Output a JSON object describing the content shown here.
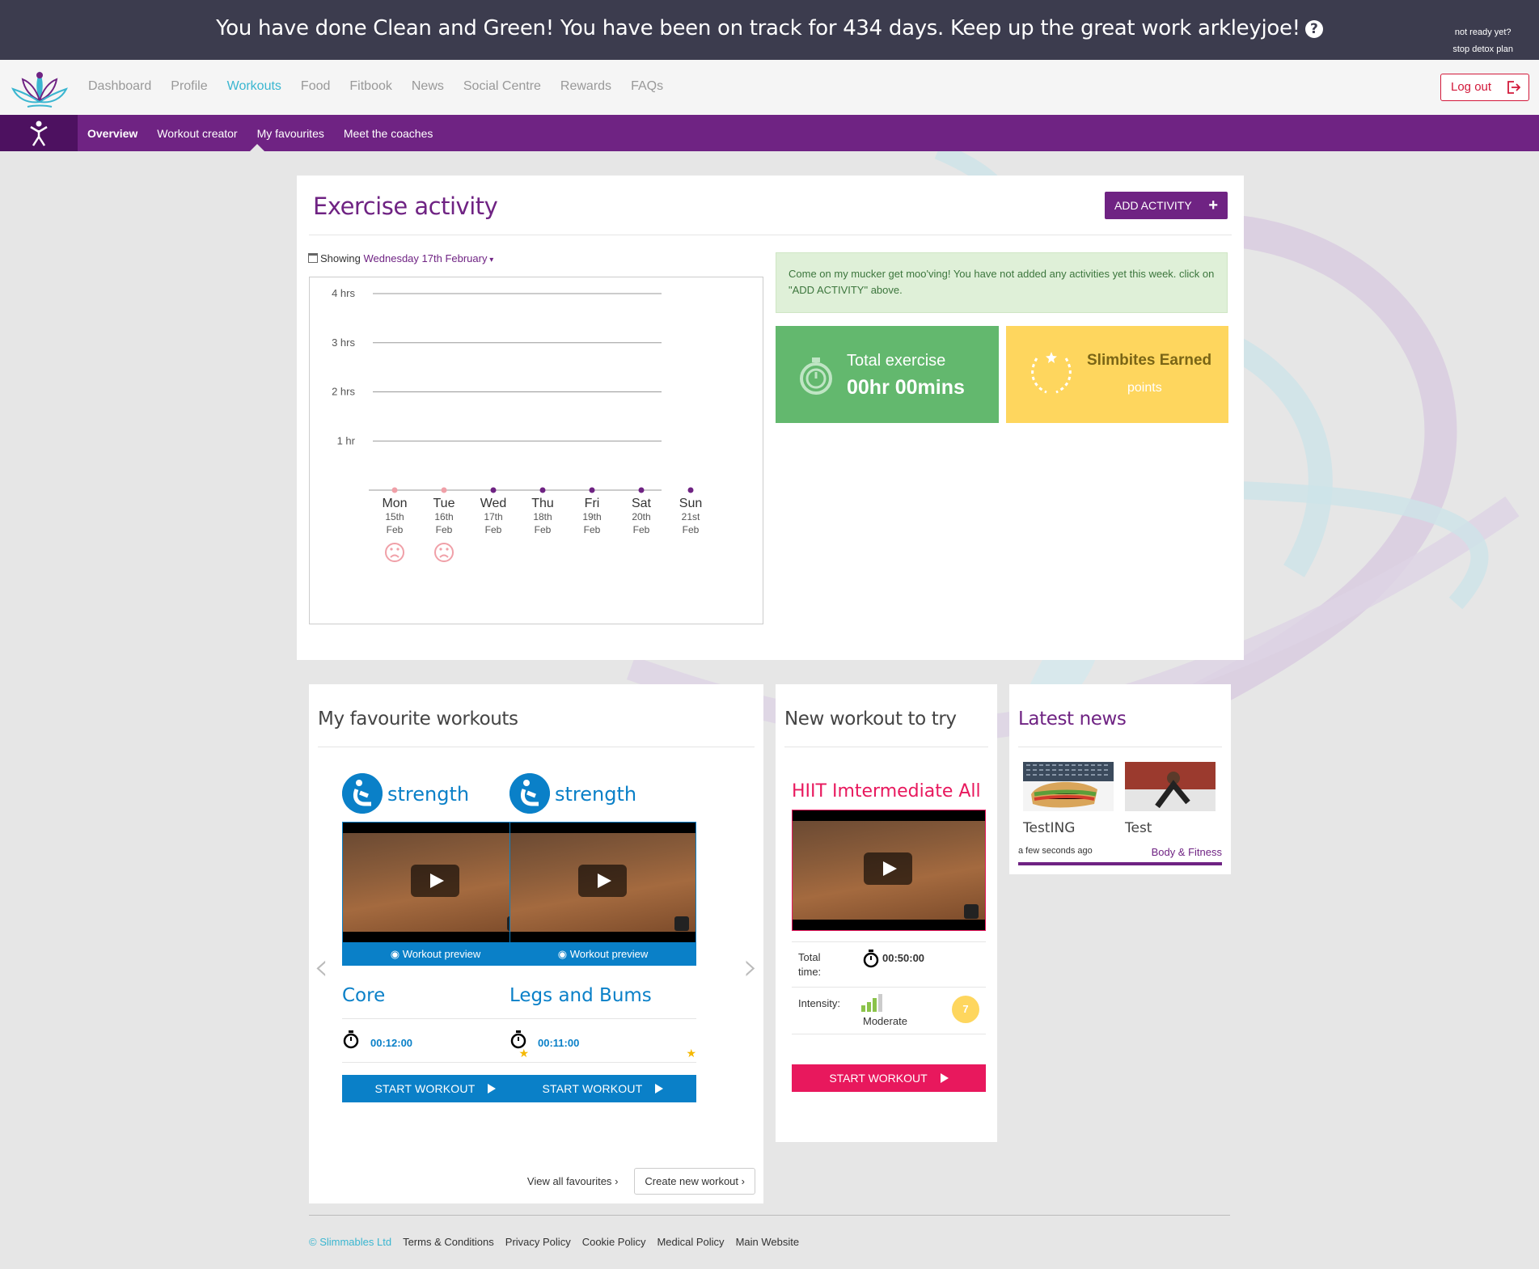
{
  "banner": {
    "message": "You have done Clean and Green! You have been on track for 434 days. Keep up the great work arkleyjoe!",
    "help_icon": "question-circle-icon",
    "side_line1": "not ready yet?",
    "side_line2": "stop detox plan"
  },
  "nav": {
    "items": [
      {
        "label": "Dashboard",
        "active": false
      },
      {
        "label": "Profile",
        "active": false
      },
      {
        "label": "Workouts",
        "active": true
      },
      {
        "label": "Food",
        "active": false
      },
      {
        "label": "Fitbook",
        "active": false
      },
      {
        "label": "News",
        "active": false
      },
      {
        "label": "Social Centre",
        "active": false
      },
      {
        "label": "Rewards",
        "active": false
      },
      {
        "label": "FAQs",
        "active": false
      }
    ],
    "logout": "Log out"
  },
  "subnav": {
    "items": [
      {
        "label": "Overview",
        "active": true
      },
      {
        "label": "Workout creator",
        "active": false
      },
      {
        "label": "My favourites",
        "active": false
      },
      {
        "label": "Meet the coaches",
        "active": false
      }
    ]
  },
  "exercise": {
    "title": "Exercise activity",
    "add_button": "ADD ACTIVITY",
    "showing_label": "Showing",
    "showing_date": "Wednesday 17th February",
    "alert": "Come on my mucker get moo'ving! You have not added any activities yet this week. click on \"ADD ACTIVITY\" above.",
    "total_label": "Total exercise",
    "total_value": "00hr 00mins",
    "slimbites_label": "Slimbites Earned",
    "slimbites_value": "points"
  },
  "chart_data": {
    "type": "line",
    "y_ticks": [
      "1 hr",
      "2 hrs",
      "3 hrs",
      "4 hrs"
    ],
    "ylim": [
      0,
      4
    ],
    "grid": true,
    "categories": [
      {
        "day": "Mon",
        "date": "15th",
        "month": "Feb",
        "sad": true
      },
      {
        "day": "Tue",
        "date": "16th",
        "month": "Feb",
        "sad": true
      },
      {
        "day": "Wed",
        "date": "17th",
        "month": "Feb",
        "sad": false
      },
      {
        "day": "Thu",
        "date": "18th",
        "month": "Feb",
        "sad": false
      },
      {
        "day": "Fri",
        "date": "19th",
        "month": "Feb",
        "sad": false
      },
      {
        "day": "Sat",
        "date": "20th",
        "month": "Feb",
        "sad": false
      },
      {
        "day": "Sun",
        "date": "21st",
        "month": "Feb",
        "sad": false
      }
    ],
    "values": [
      0,
      0,
      0,
      0,
      0,
      0,
      0
    ],
    "colors": {
      "past": "#f0a0a8",
      "future": "#6f2383",
      "sad": "#f0a0a8"
    }
  },
  "favourites": {
    "title": "My favourite workouts",
    "cards": [
      {
        "category": "strength",
        "preview": "Workout preview",
        "name": "Core",
        "time": "00:12:00",
        "start": "START WORKOUT"
      },
      {
        "category": "strength",
        "preview": "Workout preview",
        "name": "Legs and Bums",
        "time": "00:11:00",
        "start": "START WORKOUT"
      }
    ],
    "view_all": "View all favourites",
    "create": "Create new workout"
  },
  "new_workout": {
    "title": "New workout to try",
    "name": "HIIT Imtermediate All",
    "total_label": "Total time:",
    "total_value": "00:50:00",
    "intensity_label": "Intensity:",
    "intensity_value": "Moderate",
    "intensity_badge": "7",
    "start": "START WORKOUT"
  },
  "news": {
    "title": "Latest news",
    "items": [
      {
        "title": "TestING"
      },
      {
        "title": "Test"
      }
    ],
    "meta": "a few seconds ago",
    "category": "Body & Fitness"
  },
  "footer": {
    "copyright": "© Slimmables Ltd",
    "links": [
      "Terms & Conditions",
      "Privacy Policy",
      "Cookie Policy",
      "Medical Policy",
      "Main Website"
    ]
  },
  "colors": {
    "purple": "#6f2383",
    "blue": "#0a80c8",
    "pink": "#e8185d",
    "green": "#63b86e",
    "yellow": "#fed65e",
    "teal": "#3ab6d0"
  }
}
